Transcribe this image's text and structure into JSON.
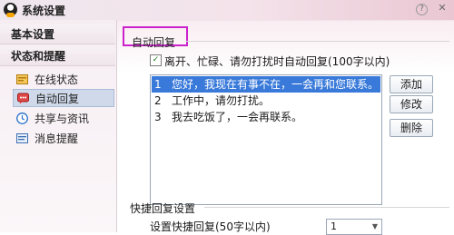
{
  "window": {
    "title": "系统设置",
    "help_glyph": "?",
    "close_glyph": "✕"
  },
  "sidebar": {
    "sections": [
      {
        "label": "基本设置"
      },
      {
        "label": "状态和提醒"
      }
    ],
    "items": [
      {
        "label": "在线状态",
        "icon": "status-icon"
      },
      {
        "label": "自动回复",
        "icon": "auto-reply-icon",
        "active": true
      },
      {
        "label": "共享与资讯",
        "icon": "clock-icon"
      },
      {
        "label": "消息提醒",
        "icon": "message-icon"
      }
    ]
  },
  "auto_reply": {
    "title": "自动回复",
    "checkbox_checked": true,
    "checkbox_glyph": "✓",
    "checkbox_label": "离开、忙碌、请勿打扰时自动回复(100字以内)",
    "messages": [
      {
        "num": "1",
        "text": "您好，我现在有事不在，一会再和您联系。",
        "selected": true
      },
      {
        "num": "2",
        "text": "工作中，请勿打扰。"
      },
      {
        "num": "3",
        "text": "我去吃饭了，一会再联系。"
      }
    ],
    "buttons": {
      "add": "添加",
      "edit": "修改",
      "delete": "删除"
    }
  },
  "quick_reply": {
    "title": "快捷回复设置",
    "label": "设置快捷回复(50字以内)",
    "select_value": "1",
    "select_arrow": "▼"
  },
  "colors": {
    "selection": "#3879d9",
    "highlight_border": "#cc22cc"
  }
}
